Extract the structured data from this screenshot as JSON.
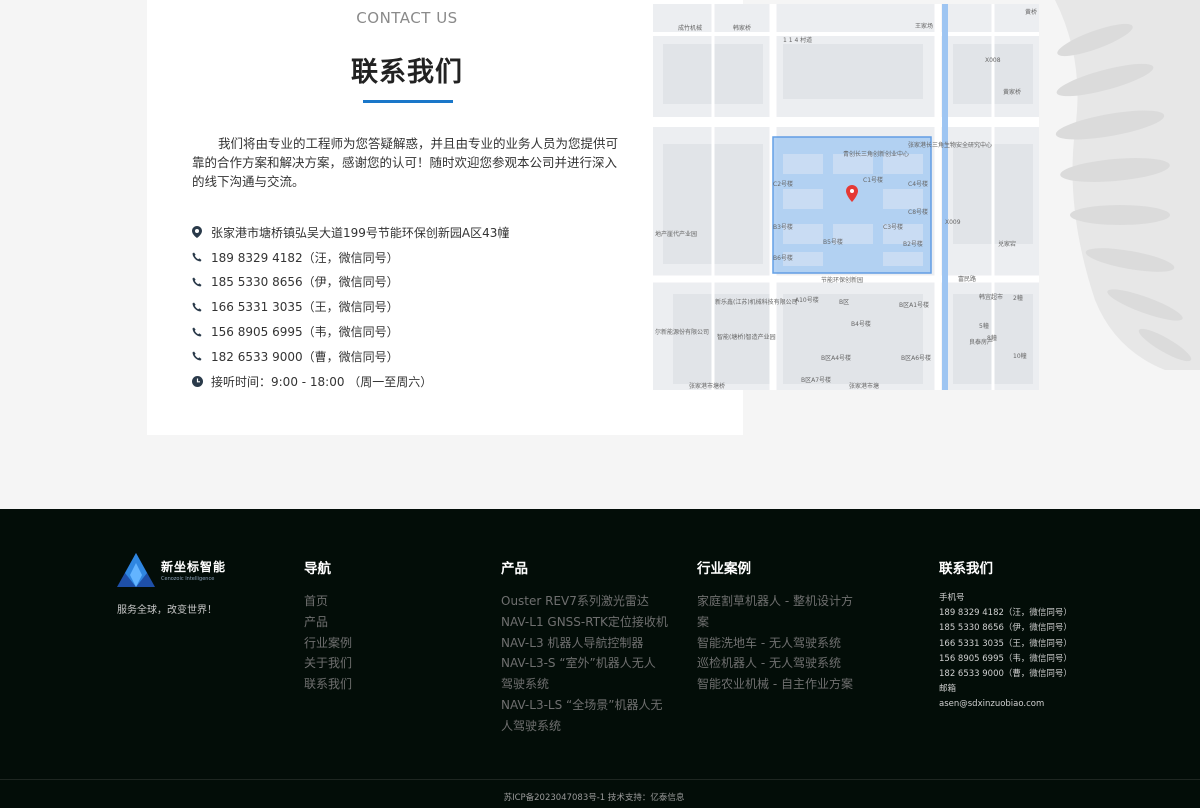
{
  "contact": {
    "title_en": "CONTACT US",
    "title_zh": "联系我们",
    "intro": "我们将由专业的工程师为您答疑解惑，并且由专业的业务人员为您提供可靠的合作方案和解决方案，感谢您的认可！随时欢迎您参观本公司并进行深入的线下沟通与交流。",
    "items": [
      {
        "icon": "location-pin-icon",
        "text": "张家港市塘桥镇弘吴大道199号节能环保创新园A区43幢"
      },
      {
        "icon": "phone-icon",
        "text": "189 8329 4182（汪，微信同号）"
      },
      {
        "icon": "phone-icon",
        "text": "185 5330 8656（伊，微信同号）"
      },
      {
        "icon": "phone-icon",
        "text": "166 5331 3035（王，微信同号）"
      },
      {
        "icon": "phone-icon",
        "text": "156 8905 6995（韦，微信同号）"
      },
      {
        "icon": "phone-icon",
        "text": "182 6533 9000（曹，微信同号）"
      },
      {
        "icon": "clock-icon",
        "text": "接听时间：9:00 - 18:00 （周一至周六）"
      }
    ]
  },
  "map": {
    "labels": [
      "成竹机械",
      "韩家桥",
      "1 1 4 村道",
      "王家场",
      "X008",
      "黄家桥",
      "黄桥",
      "张家港长三角生物安全研究中心",
      "青创长三角创新创业中心",
      "C1号楼",
      "C2号楼",
      "C8号楼",
      "C4号楼",
      "C3号楼",
      "B5号楼",
      "B6号楼",
      "B2号楼",
      "B3号楼",
      "节能环保创新园",
      "富民路",
      "韩宜超市",
      "兑家宕",
      "地产崖代产业园",
      "新乐鑫(江苏)机械科技有限公司",
      "A10号楼",
      "B区",
      "B区A1号楼",
      "B4号楼",
      "尔新能源份有限公司",
      "智能(塘桥)智造产业园",
      "B区A4号楼",
      "B区A6号楼",
      "B区A7号楼",
      "张家港市塘桥",
      "张家港市塘",
      "良泰房产",
      "2幢",
      "5幢",
      "8幢",
      "10幢",
      "X009"
    ],
    "accent": "#4a90e2"
  },
  "footer": {
    "logo_cn": "新坐标智能",
    "logo_en": "Cenozoic Intelligence",
    "slogan": "服务全球，改变世界！",
    "nav": {
      "title": "导航",
      "items": [
        "首页",
        "产品",
        "行业案例",
        "关于我们",
        "联系我们"
      ]
    },
    "products": {
      "title": "产品",
      "items": [
        [
          "Ouster REV7系列激光雷达"
        ],
        [
          "NAV-L1 GNSS-RTK定位接收机"
        ],
        [
          "NAV-L3 机器人导航控制器"
        ],
        [
          "NAV-L3-S “室外”机器人无人",
          "驾驶系统"
        ],
        [
          "NAV-L3-LS “全场景”机器人无",
          "人驾驶系统"
        ]
      ]
    },
    "cases": {
      "title": "行业案例",
      "items": [
        [
          "家庭割草机器人 - 整机设计方",
          "案"
        ],
        [
          "智能洗地车 - 无人驾驶系统"
        ],
        [
          "巡检机器人 - 无人驾驶系统"
        ],
        [
          "智能农业机械 - 自主作业方案"
        ]
      ]
    },
    "contact": {
      "title": "联系我们",
      "phone_label": "手机号",
      "phones": [
        "189 8329 4182（汪，微信同号）",
        "185 5330 8656（伊，微信同号）",
        "166 5331 3035（王，微信同号）",
        "156 8905 6995（韦，微信同号）",
        "182 6533 9000（曹，微信同号）"
      ],
      "email_label": "邮箱",
      "email": "asen@sdxinzuobiao.com"
    },
    "copyright": "苏ICP备2023047083号-1 技术支持：亿泰信息"
  },
  "colors": {
    "accent_blue": "#1a77c9",
    "footer_bg": "#030d08",
    "map_marker": "#e53935"
  }
}
